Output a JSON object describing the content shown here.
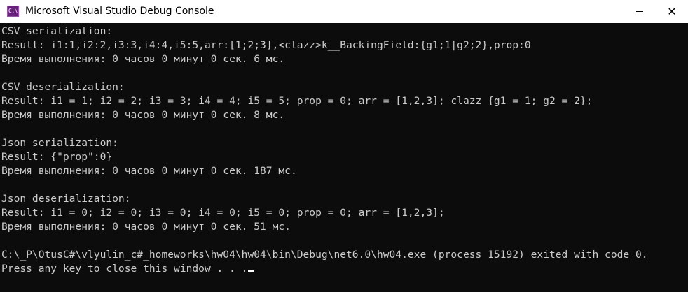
{
  "window": {
    "title": "Microsoft Visual Studio Debug Console",
    "icon_label": "C:\\"
  },
  "controls": {
    "minimize_icon": "minimize-icon",
    "close_icon": "close-icon",
    "close_glyph": "✕"
  },
  "console": {
    "lines": [
      "CSV serialization:",
      "Result: i1:1,i2:2,i3:3,i4:4,i5:5,arr:[1;2;3],<clazz>k__BackingField:{g1;1|g2;2},prop:0",
      "Время выполнения: 0 часов 0 минут 0 сек. 6 мс.",
      "",
      "CSV deserialization:",
      "Result: i1 = 1; i2 = 2; i3 = 3; i4 = 4; i5 = 5; prop = 0; arr = [1,2,3]; clazz {g1 = 1; g2 = 2};",
      "Время выполнения: 0 часов 0 минут 0 сек. 8 мс.",
      "",
      "Json serialization:",
      "Result: {\"prop\":0}",
      "Время выполнения: 0 часов 0 минут 0 сек. 187 мс.",
      "",
      "Json deserialization:",
      "Result: i1 = 0; i2 = 0; i3 = 0; i4 = 0; i5 = 0; prop = 0; arr = [1,2,3];",
      "Время выполнения: 0 часов 0 минут 0 сек. 51 мс.",
      "",
      "C:\\_P\\OtusC#\\vlyulin_c#_homeworks\\hw04\\hw04\\bin\\Debug\\net6.0\\hw04.exe (process 15192) exited with code 0.",
      "Press any key to close this window . . ."
    ]
  },
  "colors": {
    "console_background": "#0c0c0c",
    "console_text": "#cccccc",
    "titlebar_background": "#ffffff",
    "icon_background": "#68217a"
  }
}
